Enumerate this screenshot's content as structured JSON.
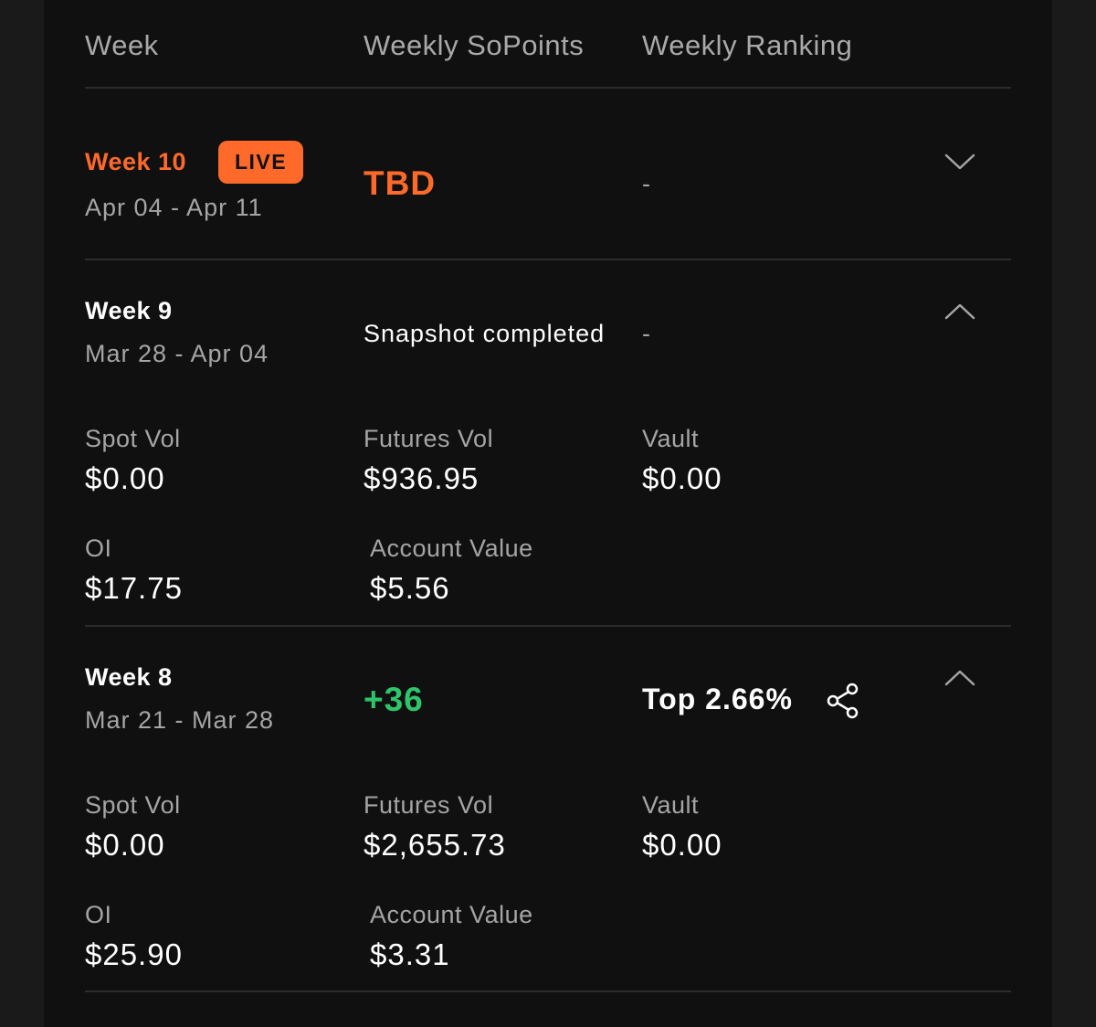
{
  "header": {
    "col_week": "Week",
    "col_points": "Weekly SoPoints",
    "col_ranking": "Weekly Ranking"
  },
  "weeks": [
    {
      "title": "Week 10",
      "badge": "LIVE",
      "range": "Apr 04 - Apr 11",
      "points": "TBD",
      "ranking": "-",
      "expanded": false
    },
    {
      "title": "Week 9",
      "range": "Mar 28 - Apr 04",
      "status": "Snapshot completed",
      "ranking": "-",
      "expanded": true,
      "stats": {
        "spot_vol_label": "Spot Vol",
        "spot_vol_value": "$0.00",
        "futures_vol_label": "Futures Vol",
        "futures_vol_value": "$936.95",
        "vault_label": "Vault",
        "vault_value": "$0.00",
        "oi_label": "OI",
        "oi_value": "$17.75",
        "account_value_label": "Account Value",
        "account_value_value": "$5.56"
      }
    },
    {
      "title": "Week 8",
      "range": "Mar 21 - Mar 28",
      "points": "+36",
      "ranking": "Top 2.66%",
      "expanded": true,
      "stats": {
        "spot_vol_label": "Spot Vol",
        "spot_vol_value": "$0.00",
        "futures_vol_label": "Futures Vol",
        "futures_vol_value": "$2,655.73",
        "vault_label": "Vault",
        "vault_value": "$0.00",
        "oi_label": "OI",
        "oi_value": "$25.90",
        "account_value_label": "Account Value",
        "account_value_value": "$3.31"
      }
    }
  ],
  "colors": {
    "accent_orange": "#ff6a2b",
    "positive_green": "#2ec46a",
    "background": "#101010",
    "muted_text": "#a5a5a5"
  },
  "icons": {
    "collapsed": "chevron-down-icon",
    "expanded": "chevron-up-icon",
    "share": "share-icon"
  }
}
